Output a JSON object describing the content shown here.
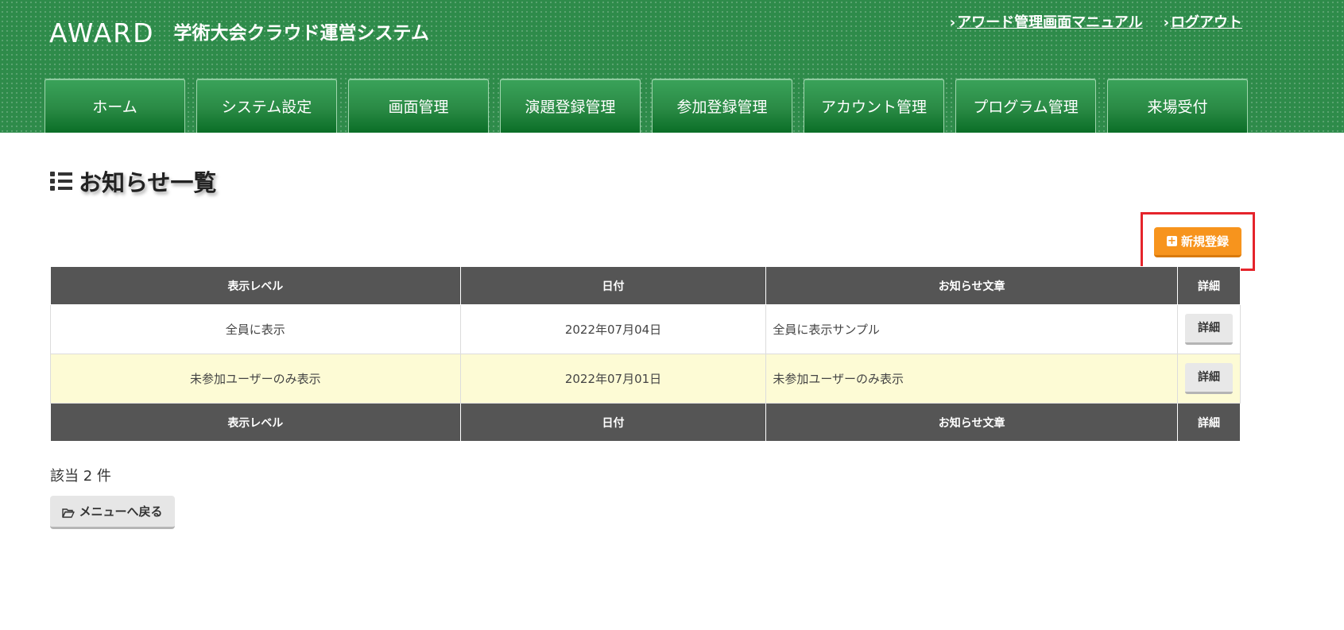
{
  "header": {
    "logo": "AWARD",
    "system_title": "学術大会クラウド運営システム",
    "links": [
      {
        "label": "アワード管理画面マニュアル"
      },
      {
        "label": "ログアウト"
      }
    ]
  },
  "nav": {
    "tabs": [
      {
        "label": "ホーム"
      },
      {
        "label": "システム設定"
      },
      {
        "label": "画面管理"
      },
      {
        "label": "演題登録管理"
      },
      {
        "label": "参加登録管理"
      },
      {
        "label": "アカウント管理"
      },
      {
        "label": "プログラム管理"
      },
      {
        "label": "来場受付"
      }
    ]
  },
  "main": {
    "page_title": "お知らせ一覧",
    "new_button_label": "新規登録",
    "table": {
      "headers": [
        "表示レベル",
        "日付",
        "お知らせ文章",
        "詳細"
      ],
      "rows": [
        {
          "level": "全員に表示",
          "date": "2022年07月04日",
          "text": "全員に表示サンプル",
          "detail": "詳細"
        },
        {
          "level": "未参加ユーザーのみ表示",
          "date": "2022年07月01日",
          "text": "未参加ユーザーのみ表示",
          "detail": "詳細"
        }
      ]
    },
    "count_text": "該当 2 件",
    "back_button_label": "メニューへ戻る"
  },
  "colors": {
    "header_green": "#2e8b4a",
    "accent_orange": "#f7941d",
    "table_header": "#555555",
    "row_highlight": "#fdfbd5",
    "annotation_red": "#e5242b"
  }
}
